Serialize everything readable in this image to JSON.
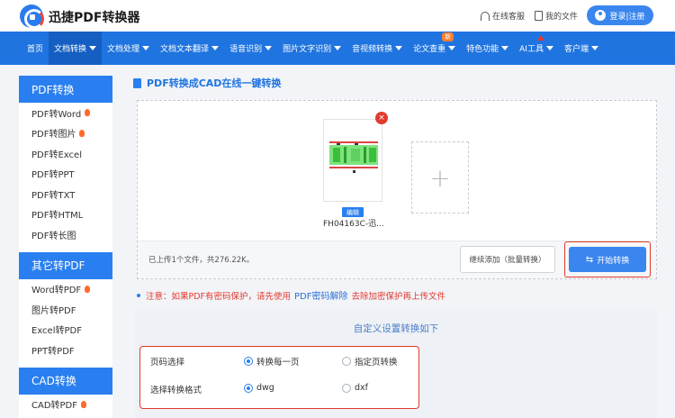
{
  "header": {
    "brand": "迅捷PDF转换器",
    "online_service": "在线客服",
    "my_files": "我的文件",
    "login": "登录|注册"
  },
  "nav": {
    "items": [
      {
        "label": "首页"
      },
      {
        "label": "文档转换"
      },
      {
        "label": "文档处理"
      },
      {
        "label": "文档文本翻译"
      },
      {
        "label": "语音识别"
      },
      {
        "label": "图片文字识别"
      },
      {
        "label": "音视频转换"
      },
      {
        "label": "论文查重"
      },
      {
        "label": "特色功能"
      },
      {
        "label": "AI工具"
      },
      {
        "label": "客户端"
      }
    ],
    "new_badge": "新"
  },
  "sidebar": {
    "sections": [
      {
        "title": "PDF转换",
        "items": [
          "PDF转Word",
          "PDF转图片",
          "PDF转Excel",
          "PDF转PPT",
          "PDF转TXT",
          "PDF转HTML",
          "PDF转长图"
        ]
      },
      {
        "title": "其它转PDF",
        "items": [
          "Word转PDF",
          "图片转PDF",
          "Excel转PDF",
          "PPT转PDF"
        ]
      },
      {
        "title": "CAD转换",
        "items": [
          "CAD转PDF"
        ]
      }
    ]
  },
  "main": {
    "title": "PDF转换成CAD在线一键转换",
    "file": {
      "name": "FH04163C-迅...",
      "edit_label": "编辑"
    },
    "upload_info": "已上传1个文件，共276.22K。",
    "continue_button": "继续添加（批量转换）",
    "start_button": "开始转换",
    "notice_prefix": "注意：如果PDF有密码保护，请先使用",
    "notice_link": "PDF密码解除",
    "notice_suffix": "去除加密保护再上传文件",
    "settings_title": "自定义设置转换如下",
    "page_label": "页码选择",
    "page_opt1": "转换每一页",
    "page_opt2": "指定页转换",
    "format_label": "选择转换格式",
    "format_opt1": "dwg",
    "format_opt2": "dxf"
  }
}
